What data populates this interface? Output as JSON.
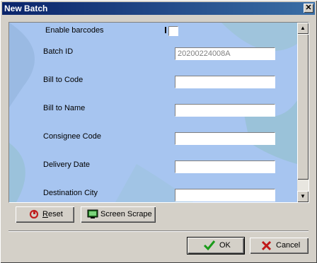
{
  "window": {
    "title": "New Batch",
    "close_glyph": "✕"
  },
  "form": {
    "enable_barcodes_label": "Enable barcodes",
    "enable_barcodes_checked": false,
    "fields": [
      {
        "label": "Batch ID",
        "value": "20200224008A",
        "readonly": true
      },
      {
        "label": "Bill to Code",
        "value": ""
      },
      {
        "label": "Bill to Name",
        "value": ""
      },
      {
        "label": "Consignee Code",
        "value": ""
      },
      {
        "label": "Delivery Date",
        "value": ""
      },
      {
        "label": "Destination City",
        "value": ""
      }
    ]
  },
  "buttons": {
    "reset": {
      "label": "Reset",
      "icon": "reset-icon"
    },
    "screen_scrape": {
      "label": "Screen Scrape",
      "icon": "screen-icon"
    },
    "ok": {
      "label": "OK",
      "icon": "checkmark-icon"
    },
    "cancel": {
      "label": "Cancel",
      "icon": "x-icon"
    }
  },
  "scroll": {
    "up": "▲",
    "down": "▼"
  }
}
